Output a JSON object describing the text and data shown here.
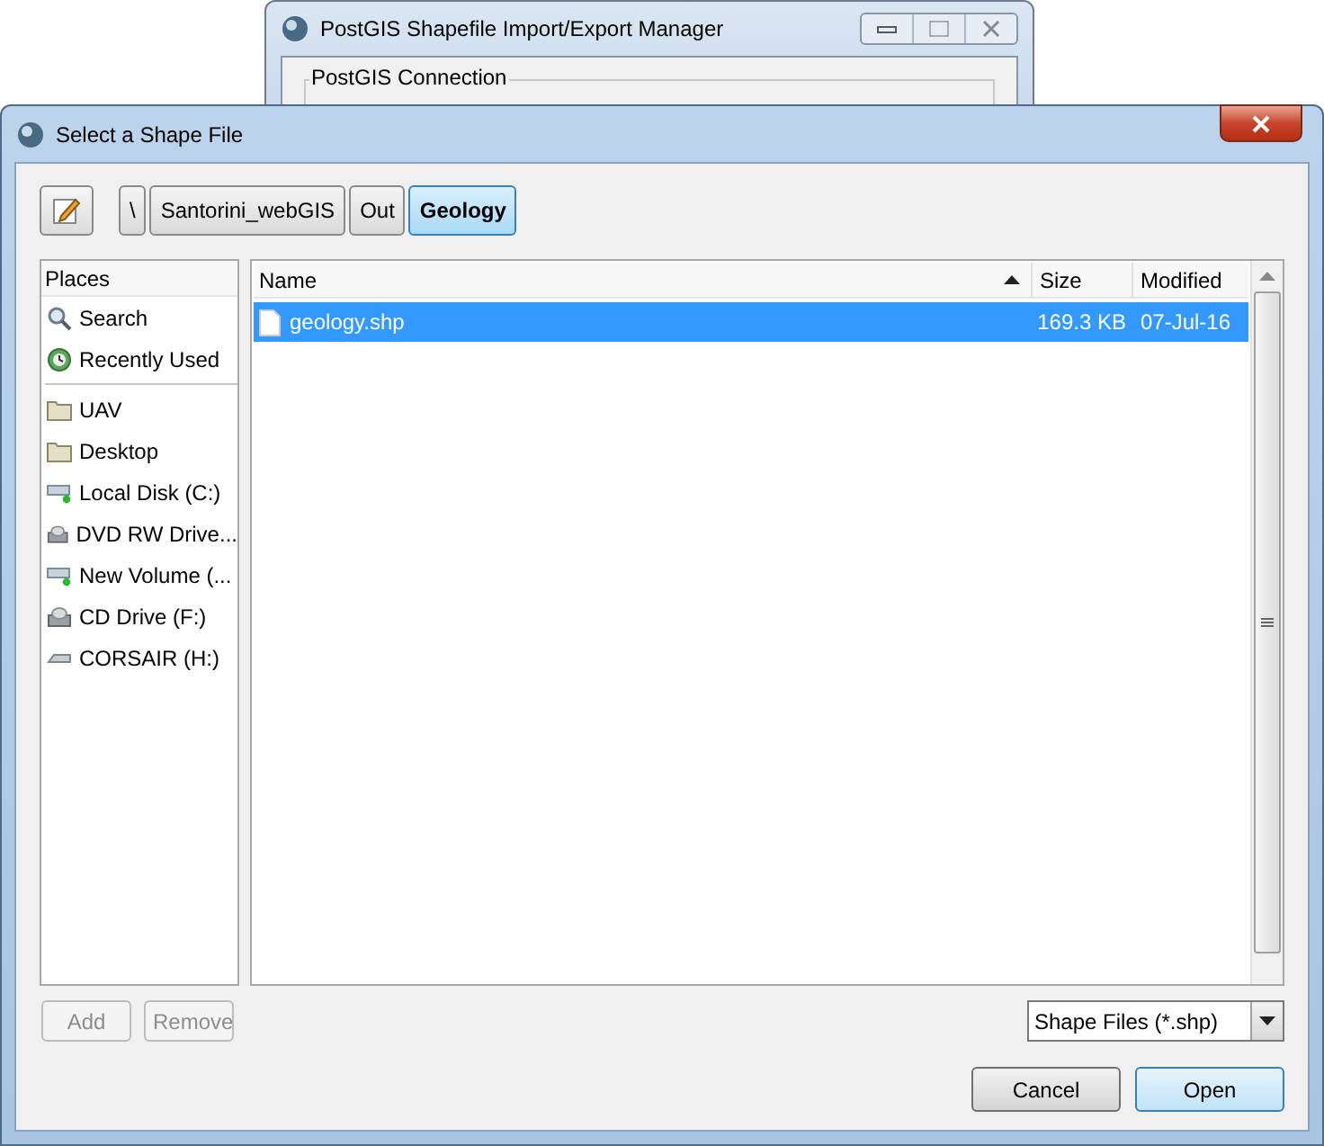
{
  "background_window": {
    "title": "PostGIS Shapefile Import/Export Manager",
    "group_label": "PostGIS Connection"
  },
  "dialog": {
    "title": "Select a Shape File"
  },
  "path_bar": [
    {
      "label": "\\",
      "selected": false
    },
    {
      "label": "Santorini_webGIS",
      "selected": false
    },
    {
      "label": "Out",
      "selected": false
    },
    {
      "label": "Geology",
      "selected": true
    }
  ],
  "places": {
    "header": "Places",
    "items": [
      {
        "label": "Search",
        "kind": "search"
      },
      {
        "label": "Recently Used",
        "kind": "recent"
      },
      {
        "label": "UAV",
        "kind": "folder"
      },
      {
        "label": "Desktop",
        "kind": "folder"
      },
      {
        "label": "Local Disk (C:)",
        "kind": "disk"
      },
      {
        "label": "DVD RW Drive...",
        "kind": "optical"
      },
      {
        "label": "New Volume (...",
        "kind": "disk"
      },
      {
        "label": "CD Drive (F:)",
        "kind": "optical"
      },
      {
        "label": "CORSAIR (H:)",
        "kind": "removable"
      }
    ]
  },
  "files": {
    "columns": [
      {
        "label": "Name",
        "sorted": true
      },
      {
        "label": "Size",
        "sorted": false
      },
      {
        "label": "Modified",
        "sorted": false
      }
    ],
    "rows": [
      {
        "name": "geology.shp",
        "size": "169.3 KB",
        "modified": "07-Jul-16",
        "selected": true
      }
    ]
  },
  "add_button": {
    "label": "Add",
    "disabled": true
  },
  "remove_button": {
    "label": "Remove",
    "disabled": true
  },
  "filter": {
    "value": "Shape Files (*.shp)"
  },
  "cancel_button": {
    "label": "Cancel",
    "default": false
  },
  "open_button": {
    "label": "Open",
    "default": true
  }
}
